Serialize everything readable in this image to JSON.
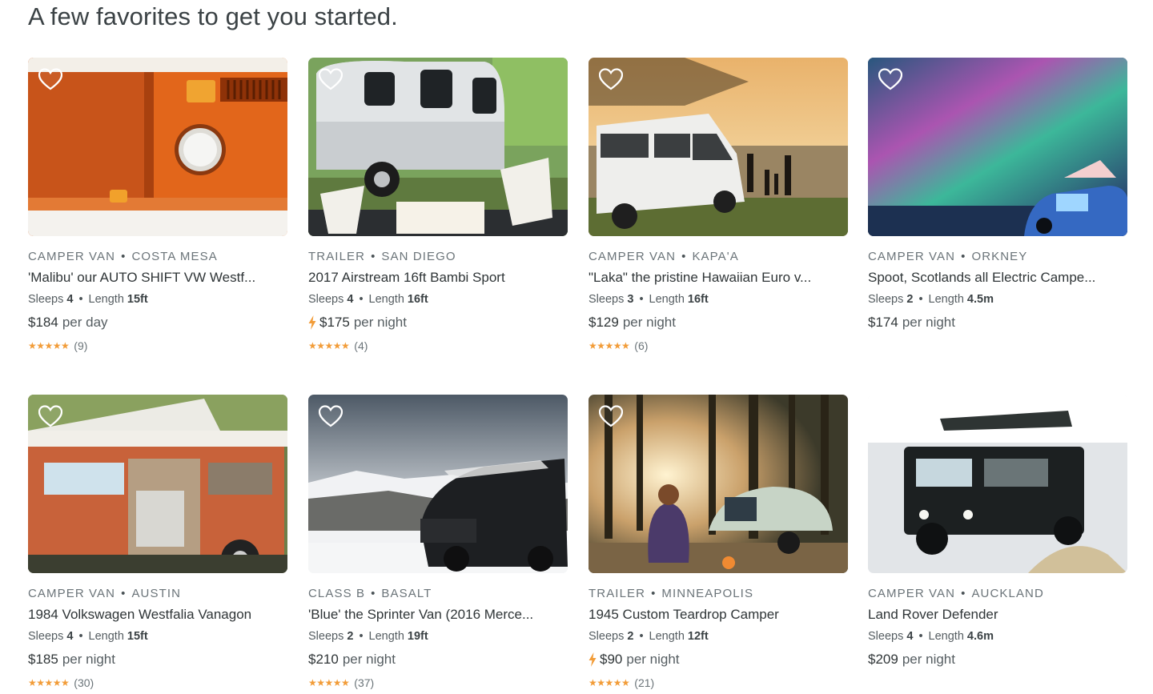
{
  "heading": "A few favorites to get you started.",
  "colors": {
    "star": "#f29c38",
    "bolt": "#f29c38",
    "text": "#2f3537",
    "muted": "#6b7479"
  },
  "listings": [
    {
      "type": "CAMPER VAN",
      "location": "COSTA MESA",
      "title": "'Malibu' our AUTO SHIFT VW Westf...",
      "sleeps_label": "Sleeps",
      "sleeps": "4",
      "length_label": "Length",
      "length": "15ft",
      "price": "$184",
      "unit": "per day",
      "instant": false,
      "stars": "★★★★★",
      "reviews": "(9)",
      "image": "orange-vw-bus-headlight"
    },
    {
      "type": "TRAILER",
      "location": "SAN DIEGO",
      "title": "2017 Airstream 16ft Bambi Sport",
      "sleeps_label": "Sleeps",
      "sleeps": "4",
      "length_label": "Length",
      "length": "16ft",
      "price": "$175",
      "unit": "per night",
      "instant": true,
      "stars": "★★★★★",
      "reviews": "(4)",
      "image": "silver-airstream-trailer"
    },
    {
      "type": "CAMPER VAN",
      "location": "KAPA'A",
      "title": "\"Laka\" the pristine Hawaiian Euro v...",
      "sleeps_label": "Sleeps",
      "sleeps": "3",
      "length_label": "Length",
      "length": "16ft",
      "price": "$129",
      "unit": "per night",
      "instant": false,
      "stars": "★★★★★",
      "reviews": "(6)",
      "image": "white-van-beach-sunset"
    },
    {
      "type": "CAMPER VAN",
      "location": "ORKNEY",
      "title": "Spoot, Scotlands all Electric Campe...",
      "sleeps_label": "Sleeps",
      "sleeps": "2",
      "length_label": "Length",
      "length": "4.5m",
      "price": "$174",
      "unit": "per night",
      "instant": false,
      "stars": "",
      "reviews": "",
      "image": "electric-van-northern-lights"
    },
    {
      "type": "CAMPER VAN",
      "location": "AUSTIN",
      "title": "1984 Volkswagen Westfalia Vanagon",
      "sleeps_label": "Sleeps",
      "sleeps": "4",
      "length_label": "Length",
      "length": "15ft",
      "price": "$185",
      "unit": "per night",
      "instant": false,
      "stars": "★★★★★",
      "reviews": "(30)",
      "image": "orange-vanagon-poptop"
    },
    {
      "type": "CLASS B",
      "location": "BASALT",
      "title": "'Blue' the Sprinter Van (2016 Merce...",
      "sleeps_label": "Sleeps",
      "sleeps": "2",
      "length_label": "Length",
      "length": "19ft",
      "price": "$210",
      "unit": "per night",
      "instant": false,
      "stars": "★★★★★",
      "reviews": "(37)",
      "image": "sprinter-van-snowy-mountains"
    },
    {
      "type": "TRAILER",
      "location": "MINNEAPOLIS",
      "title": "1945 Custom Teardrop Camper",
      "sleeps_label": "Sleeps",
      "sleeps": "2",
      "length_label": "Length",
      "length": "12ft",
      "price": "$90",
      "unit": "per night",
      "instant": true,
      "stars": "★★★★★",
      "reviews": "(21)",
      "image": "teardrop-camper-forest"
    },
    {
      "type": "CAMPER VAN",
      "location": "AUCKLAND",
      "title": "Land Rover Defender",
      "sleeps_label": "Sleeps",
      "sleeps": "4",
      "length_label": "Length",
      "length": "4.6m",
      "price": "$209",
      "unit": "per night",
      "instant": false,
      "stars": "",
      "reviews": "",
      "image": "land-rover-sand-dunes"
    }
  ]
}
